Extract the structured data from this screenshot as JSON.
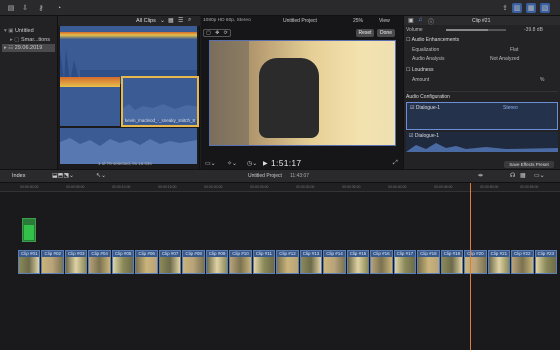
{
  "browser": {
    "filter_label": "All Clips",
    "selected_clip_label": "kevin_macleod_-_sneaky_snitch_8",
    "status": "1 of 70 selected, 0s 16.03s"
  },
  "library": {
    "name": "Untitled",
    "events_label": "Smar...tions",
    "date_label": "29.06.2019"
  },
  "viewer": {
    "format": "1080p HD 60p, Stereo",
    "project": "Untitled Project",
    "zoom": "25%",
    "view_label": "View",
    "reset_label": "Reset",
    "done_label": "Done",
    "timecode": "1:51:17"
  },
  "inspector": {
    "clip_name": "Clip #21",
    "volume_label": "Volume",
    "volume_value": "-39.8 dB",
    "audio_enh_label": "Audio Enhancements",
    "eq_label": "Equalization",
    "eq_value": "Flat",
    "analysis_label": "Audio Analysis",
    "analysis_value": "Not Analyzed",
    "loudness_label": "Loudness",
    "amount_label": "Amount",
    "amount_value": "%",
    "config_label": "Audio Configuration",
    "channel_label": "Dialogue-1",
    "channel_mode": "Stereo",
    "sub_label": "Dialogue-1",
    "save_preset": "Save Effects Preset"
  },
  "timeline": {
    "index_label": "Index",
    "project": "Untitled Project",
    "duration": "11:43:07",
    "ruler_ticks": [
      "00:00:00:00",
      "00:00:05:00",
      "00:00:10:00",
      "00:00:15:00",
      "00:00:20:00",
      "00:00:25:00",
      "00:00:30:00",
      "00:00:35:00",
      "00:00:40:00",
      "00:00:45:00",
      "00:00:50:00",
      "00:00:55:00"
    ],
    "clips": [
      "Clip #01",
      "Clip #02",
      "Clip #03",
      "Clip #04",
      "Clip #05",
      "Clip #06",
      "Clip #07",
      "Clip #08",
      "Clip #09",
      "Clip #10",
      "Clip #11",
      "Clip #12",
      "Clip #13",
      "Clip #14",
      "Clip #15",
      "Clip #16",
      "Clip #17",
      "Clip #18",
      "Clip #19",
      "Clip #20",
      "Clip #21",
      "Clip #22",
      "Clip #23"
    ]
  },
  "colors": {
    "accent": "#3b6fd0",
    "playhead": "#e07a3b",
    "clip_blue": "#3a5a8c"
  }
}
